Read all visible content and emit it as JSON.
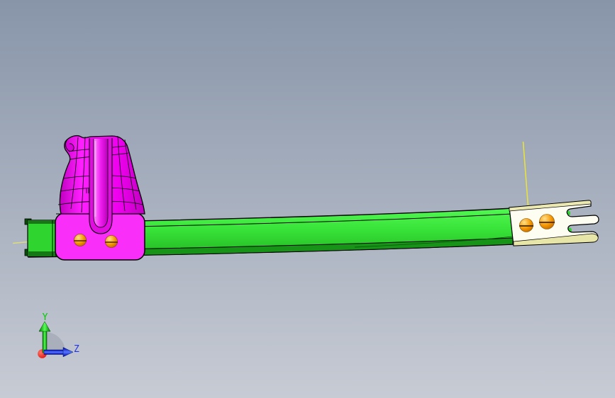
{
  "axis_triad": {
    "y_label": "Y",
    "z_label": "Z"
  },
  "colors": {
    "bg_top": "#8895a9",
    "bg_bottom": "#c7cbd4",
    "beam_light": "#52f852",
    "beam_mid": "#38e238",
    "beam_dark": "#22b422",
    "beam_flange": "#179317",
    "beam_end_face": "#2fd42f",
    "beam_tab_dark": "#0a4f0a",
    "bracket_plate": "#f92ef9",
    "bracket_body_light": "#ff1fff",
    "bracket_body": "#ee00ee",
    "bracket_highlight": "#ff8aff",
    "bracket_shadow": "#c000c0",
    "fitting_face": "#fdfdf2",
    "fitting_edge_top": "#ebe8b2",
    "fitting_edge_bottom": "#e8e5a8",
    "fastener_glint": "#ffe089",
    "fastener_core": "#f59600",
    "fastener_rim": "#b45f00",
    "datum_yellow": "#e8e33c",
    "datum_yellow_faint": "#dedc7a",
    "axis_y_green": "#00cc00",
    "axis_y_green_dark": "#007700",
    "axis_y_green_bright": "#55ff55",
    "axis_z_blue": "#2233ee",
    "axis_z_blue_dark": "#0000aa",
    "axis_z_blue_bright": "#5577ff",
    "axis_x_red": "#dd0000",
    "axis_x_red_bright": "#ff7766",
    "axis_sector_gray": "#a6adb9"
  }
}
